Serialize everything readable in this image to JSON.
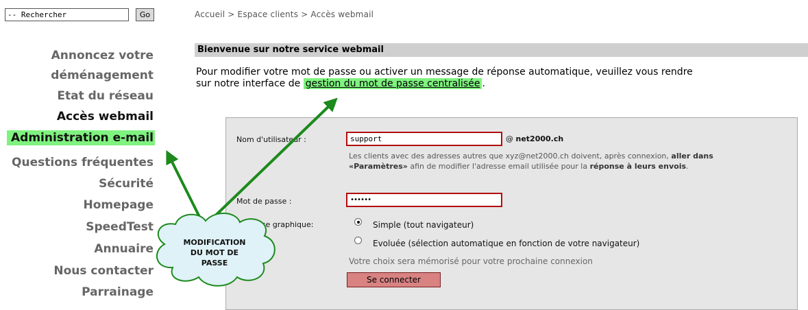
{
  "search": {
    "value": "-- Rechercher",
    "go_label": "Go"
  },
  "breadcrumb": "Accueil > Espace clients > Accès webmail",
  "sidebar": {
    "items": [
      {
        "label": "Annoncez votre"
      },
      {
        "label": "déménagement"
      },
      {
        "label": "Etat du réseau"
      },
      {
        "label": "Accès webmail"
      },
      {
        "label": "Administration e-mail"
      },
      {
        "label": "Questions fréquentes"
      },
      {
        "label": "Sécurité"
      },
      {
        "label": "Homepage"
      },
      {
        "label": "SpeedTest"
      },
      {
        "label": "Annuaire"
      },
      {
        "label": "Nous contacter"
      },
      {
        "label": "Parrainage"
      }
    ]
  },
  "main": {
    "heading": "Bienvenue sur notre service webmail",
    "intro_line1": "Pour modifier votre mot de passe ou activer un message de réponse automatique, veuillez vous rendre",
    "intro_line2_prefix": "sur notre interface de ",
    "intro_link": "gestion du mot de passe centralisée",
    "intro_line2_suffix": "."
  },
  "login": {
    "username_label": "Nom d'utilisateur :",
    "username_value": "support",
    "domain_prefix": "@ ",
    "domain": "net2000.ch",
    "help_part1": "Les clients avec des adresses autres que xyz@net2000.ch doivent, après connexion, ",
    "help_bold1": "aller dans «Paramètres»",
    "help_part2": " afin de modifier l'adresse email utilisée pour la ",
    "help_bold2": "réponse à leurs envois",
    "help_part3": ".",
    "password_label": "Mot de passe :",
    "password_value": "••••••",
    "interface_label": "Interface graphique:",
    "option_simple": "Simple (tout navigateur)",
    "option_evolved": "Evoluée (sélection automatique en fonction de votre navigateur)",
    "selected_option": "simple",
    "remember_text": "Votre choix sera mémorisé pour votre prochaine connexion",
    "connect_label": "Se connecter"
  },
  "callout": {
    "line1": "MODIFICATION",
    "line2": "DU MOT DE",
    "line3": "PASSE"
  },
  "colors": {
    "highlight": "#7ff27f",
    "arrow": "#1c8a1c",
    "field_border": "#b00d0d"
  }
}
